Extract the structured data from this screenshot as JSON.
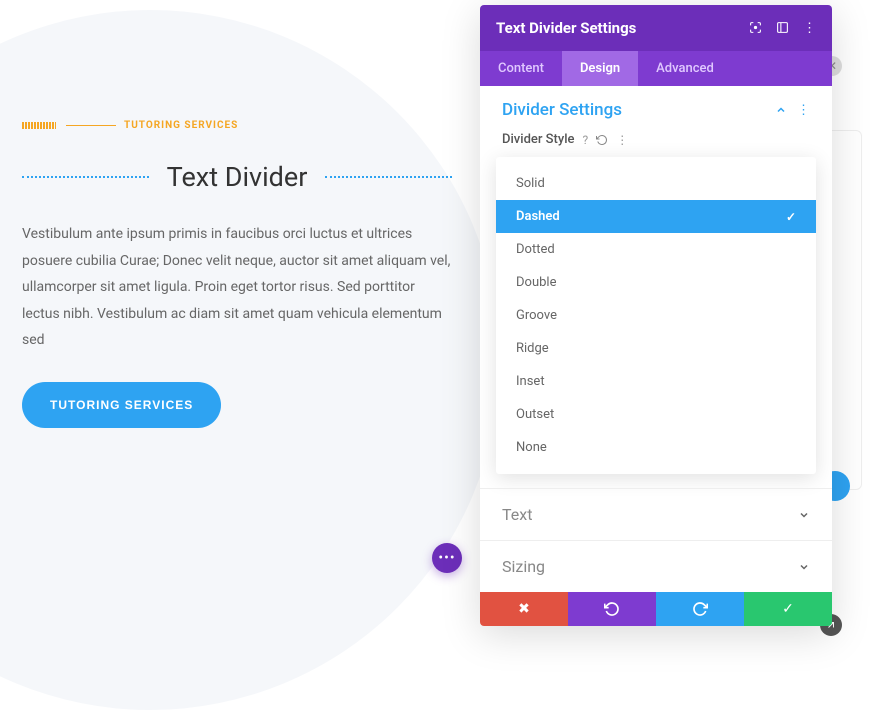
{
  "content": {
    "services_label": "TUTORING SERVICES",
    "divider_title": "Text Divider",
    "body_text": "Vestibulum ante ipsum primis in faucibus orci luctus et ultrices posuere cubilia Curae; Donec velit neque, auctor sit amet aliquam vel, ullamcorper sit amet ligula. Proin eget tortor risus. Sed porttitor lectus nibh. Vestibulum ac diam sit amet quam vehicula elementum sed",
    "cta_label": "TUTORING SERVICES"
  },
  "panel": {
    "title": "Text Divider Settings",
    "tabs": [
      "Content",
      "Design",
      "Advanced"
    ],
    "active_tab": "Design",
    "section_title": "Divider Settings",
    "field_label": "Divider Style",
    "options": [
      "Solid",
      "Dashed",
      "Dotted",
      "Double",
      "Groove",
      "Ridge",
      "Inset",
      "Outset",
      "None"
    ],
    "selected_option": "Dashed",
    "collapsed_sections": [
      "Text",
      "Sizing"
    ]
  }
}
